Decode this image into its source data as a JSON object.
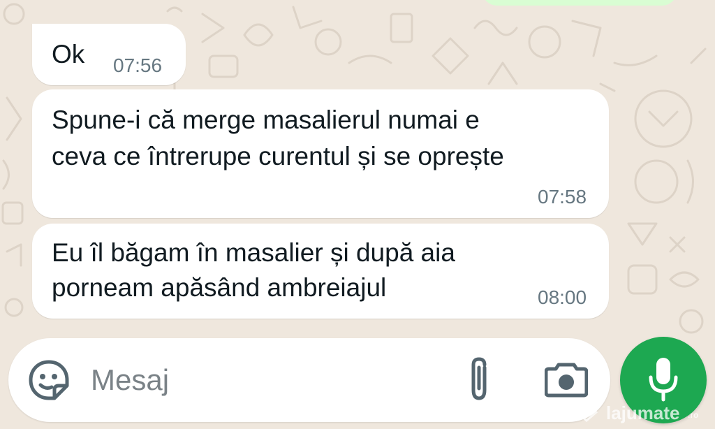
{
  "messages": [
    {
      "text_lines": [
        "Ok"
      ],
      "time": "07:56"
    },
    {
      "text_lines": [
        "Spune-i că merge masalierul numai e",
        "ceva ce întrerupe curentul și se oprește"
      ],
      "time": "07:58"
    },
    {
      "text_lines": [
        "Eu îl băgam în masalier și după aia",
        "porneam apăsând ambreiajul"
      ],
      "time": "08:00"
    }
  ],
  "composer": {
    "placeholder": "Mesaj",
    "icons": [
      "sticker-icon",
      "paperclip-icon",
      "camera-icon",
      "microphone-icon"
    ]
  },
  "watermark": {
    "brand": "lajumate",
    "tld": ".ro"
  },
  "colors": {
    "wallpaper": "#efe7dd",
    "incoming_bubble": "#ffffff",
    "outgoing_bubble": "#d9fdd3",
    "timestamp": "#667781",
    "accent_green": "#1da851"
  }
}
